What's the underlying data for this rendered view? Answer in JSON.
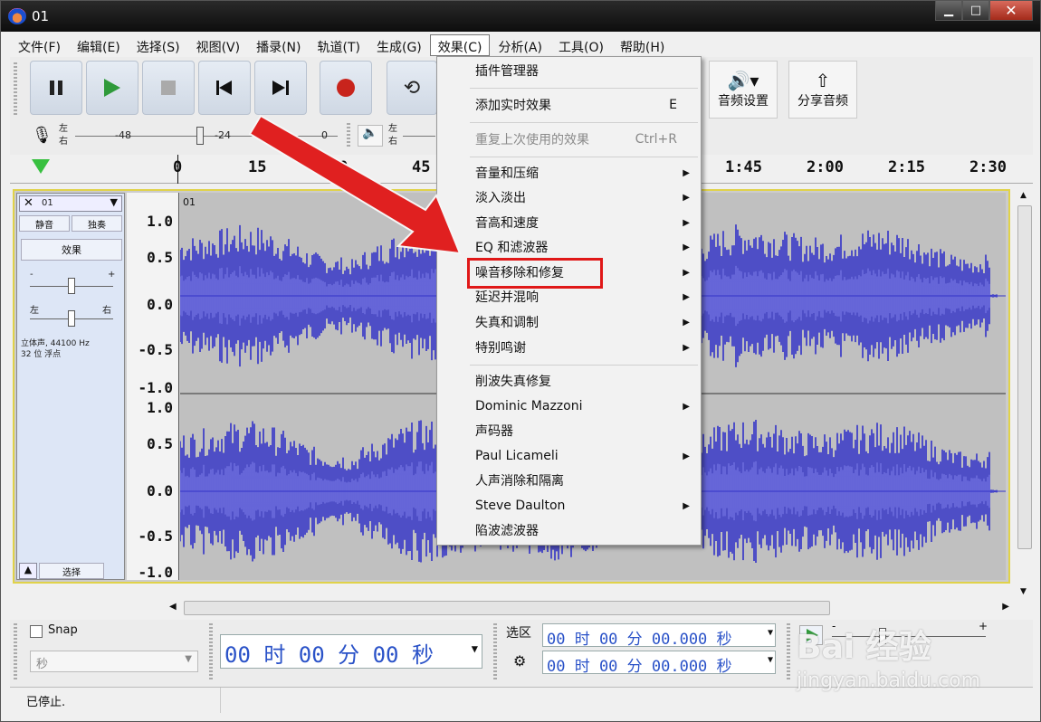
{
  "window": {
    "title": "01"
  },
  "menubar": [
    {
      "label": "文件(F)"
    },
    {
      "label": "编辑(E)"
    },
    {
      "label": "选择(S)"
    },
    {
      "label": "视图(V)"
    },
    {
      "label": "播录(N)"
    },
    {
      "label": "轨道(T)"
    },
    {
      "label": "生成(G)"
    },
    {
      "label": "效果(C)"
    },
    {
      "label": "分析(A)"
    },
    {
      "label": "工具(O)"
    },
    {
      "label": "帮助(H)"
    }
  ],
  "meters": {
    "rec": {
      "lr_top": "左",
      "lr_bottom": "右",
      "n48": "-48",
      "n24": "-24",
      "n0": "0"
    },
    "play": {
      "lr_top": "左",
      "lr_bottom": "右"
    }
  },
  "toolbar": {
    "audio_setup": "音频设置",
    "share_audio": "分享音频"
  },
  "ruler": {
    "left": [
      "0",
      "15",
      "30",
      "45"
    ],
    "right": [
      "1:45",
      "2:00",
      "2:15",
      "2:30"
    ]
  },
  "track": {
    "name": "01",
    "mute": "静音",
    "solo": "独奏",
    "effects": "效果",
    "gain_minus": "-",
    "gain_plus": "+",
    "pan_left": "左",
    "pan_right": "右",
    "info1": "立体声, 44100 Hz",
    "info2": "32 位 浮点",
    "select": "选择",
    "clip_name": "01",
    "scale_top": [
      "1.0",
      "0.5",
      "0.0",
      "-0.5",
      "-1.0"
    ],
    "scale_bottom": [
      "1.0",
      "0.5",
      "0.0",
      "-0.5",
      "-1.0"
    ]
  },
  "dropdown": {
    "items": [
      {
        "label": "插件管理器"
      },
      {
        "label": "添加实时效果",
        "shortcut": "E"
      },
      {
        "label": "重复上次使用的效果",
        "shortcut": "Ctrl+R"
      },
      {
        "label": "音量和压缩"
      },
      {
        "label": "淡入淡出"
      },
      {
        "label": "音高和速度"
      },
      {
        "label": "EQ 和滤波器"
      },
      {
        "label": "噪音移除和修复"
      },
      {
        "label": "延迟并混响"
      },
      {
        "label": "失真和调制"
      },
      {
        "label": "特别鸣谢"
      },
      {
        "label": "削波失真修复"
      },
      {
        "label": "Dominic Mazzoni"
      },
      {
        "label": "声码器"
      },
      {
        "label": "Paul Licameli"
      },
      {
        "label": "人声消除和隔离"
      },
      {
        "label": "Steve Daulton"
      },
      {
        "label": "陷波滤波器"
      }
    ]
  },
  "bottom": {
    "snap_label": "Snap",
    "snap_unit": "秒",
    "time_main": "00 时 00 分 00 秒",
    "selection_label": "选区",
    "sel_start": "00 时 00 分 00.000 秒",
    "sel_end": "00 时 00 分 00.000 秒",
    "speed_minus": "-",
    "speed_plus": "+"
  },
  "status": {
    "text": "已停止."
  },
  "watermark": {
    "brand": "Bai 经验",
    "url": "jingyan.baidu.com"
  },
  "colors": {
    "waveform": "#3232c8",
    "waveform_rms": "#6464dc",
    "highlight": "#e01818",
    "arrow": "#e02020"
  }
}
